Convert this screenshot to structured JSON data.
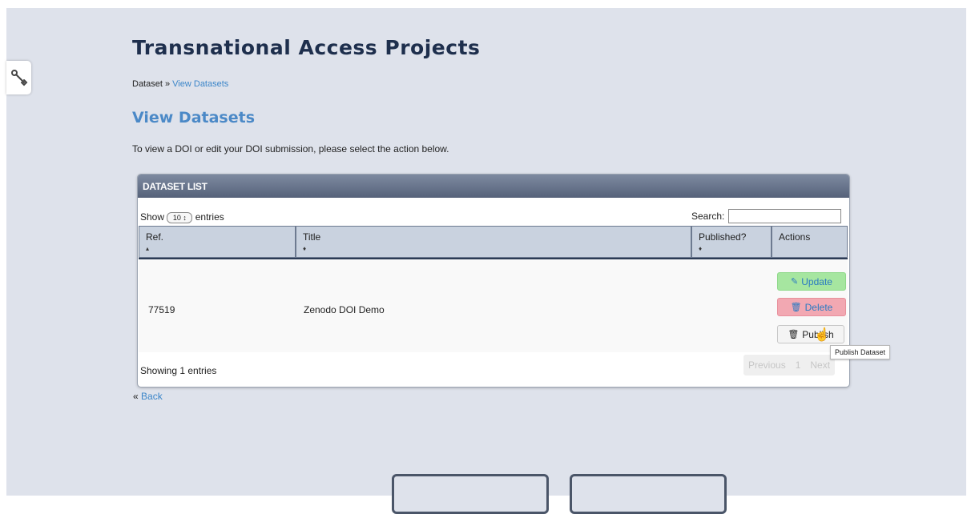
{
  "page_title": "Transnational Access Projects",
  "breadcrumb": {
    "root": "Dataset",
    "separator": "»",
    "current": "View Datasets"
  },
  "section_title": "View Datasets",
  "intro_text": "To view a DOI or edit your DOI submission, please select the action below.",
  "panel": {
    "header": "DATASET LIST",
    "show_label_before": "Show",
    "page_length": "10",
    "show_label_after": "entries",
    "search_label": "Search:",
    "search_value": "",
    "columns": [
      {
        "label": "Ref.",
        "sort": "▴"
      },
      {
        "label": "Title",
        "sort": "♦"
      },
      {
        "label": "Published?",
        "sort": "♦"
      },
      {
        "label": "Actions",
        "sort": ""
      }
    ],
    "rows": [
      {
        "ref": "77519",
        "title": "Zenodo DOI Demo",
        "published": ""
      }
    ],
    "actions": {
      "update": "Update",
      "delete": "Delete",
      "publish": "Publish"
    },
    "footer_info": "Showing 1 entries",
    "pagination": {
      "previous": "Previous",
      "page": "1",
      "next": "Next"
    }
  },
  "tooltip": "Publish Dataset",
  "back_link": {
    "prefix": "«",
    "label": "Back"
  },
  "icons": {
    "tools": "wrench-icon",
    "update": "pencil-icon",
    "delete": "trash-icon",
    "publish": "trash-icon",
    "cursor": "hand-pointer-icon"
  },
  "colors": {
    "background": "#dee2eb",
    "title": "#1e2f4d",
    "link": "#3c86c9",
    "section_title": "#4b89c7",
    "update_button": "#a6e6a0",
    "delete_button": "#f2a8b2",
    "panel_header": "#56627a"
  }
}
